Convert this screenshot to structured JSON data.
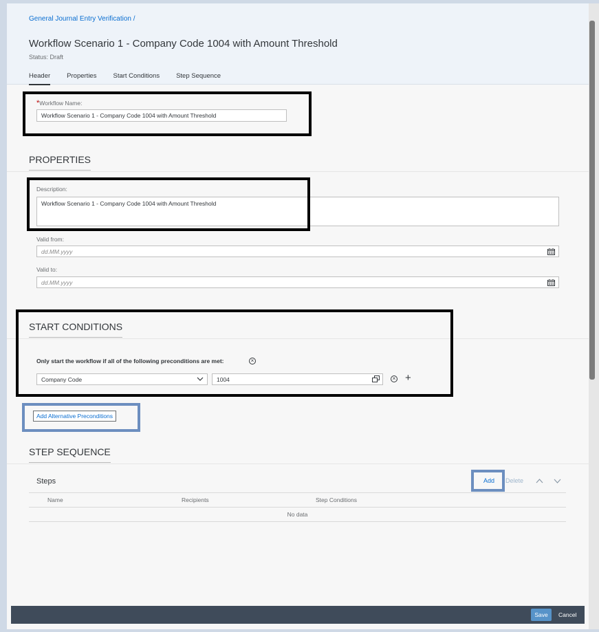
{
  "header": {
    "breadcrumb": "General Journal Entry Verification /",
    "title": "Workflow Scenario 1 - Company Code 1004 with Amount Threshold",
    "status": "Status: Draft",
    "tabs": [
      {
        "label": "Header",
        "active": true
      },
      {
        "label": "Properties"
      },
      {
        "label": "Start Conditions"
      },
      {
        "label": "Step Sequence"
      }
    ]
  },
  "header_section": {
    "workflow_name_label": "Workflow Name:",
    "required_mark": "*",
    "workflow_name_value": "Workflow Scenario 1 - Company Code 1004 with Amount Threshold"
  },
  "properties": {
    "title": "PROPERTIES",
    "description_label": "Description:",
    "description_value": "Workflow Scenario 1 - Company Code 1004 with Amount Threshold",
    "valid_from_label": "Valid from:",
    "valid_from_placeholder": "dd.MM.yyyy",
    "valid_to_label": "Valid to:",
    "valid_to_placeholder": "dd.MM.yyyy"
  },
  "start_conditions": {
    "title": "START CONDITIONS",
    "precondition_text": "Only start the workflow if all of the following preconditions are met:",
    "field_select": "Company Code",
    "field_value": "1004",
    "add_alternative_label": "Add Alternative Preconditions"
  },
  "step_sequence": {
    "title": "STEP SEQUENCE",
    "steps_label": "Steps",
    "add_label": "Add",
    "delete_label": "Delete",
    "columns": [
      "Name",
      "Recipients",
      "Step Conditions"
    ],
    "no_data": "No data"
  },
  "footer": {
    "save_label": "Save",
    "cancel_label": "Cancel"
  },
  "colors": {
    "accent": "#0a6ed1",
    "footer_bg": "#3f4b5a",
    "save_bg": "#5793c9",
    "highlight_blue": "#6c8ebf"
  }
}
